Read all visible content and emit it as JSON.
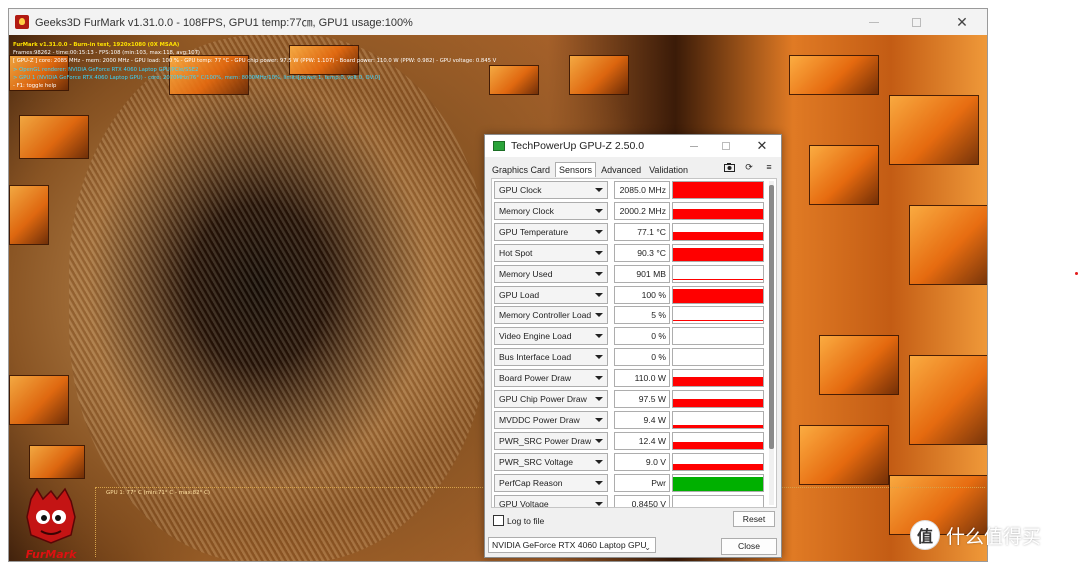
{
  "furmark": {
    "title": "Geeks3D FurMark v1.31.0.0 - 108FPS, GPU1 temp:77㎝, GPU1 usage:100%",
    "overlay": [
      "FurMark v1.31.0.0 - Burn-in test, 1920x1080 (0X MSAA)",
      "Frames:98262 - time:00:15:13 - FPS:108 (min:103, max:118, avg:107)",
      "[ GPU-Z ] core: 2085 MHz - mem: 2000 MHz - GPU load: 100 % - GPU temp: 77 °C - GPU chip power: 97.5 W (PPW: 1.107) - Board power: 110.0 W (PPW: 0.982) - GPU voltage: 0.845 V",
      "> OpenGL renderer: NVIDIA GeForce RTX 4060 Laptop GPU/PCIe/SSE2",
      "> GPU 1 (NVIDIA GeForce RTX 4060 Laptop GPU) - core: 2070MHz/76° C/100%, mem: 8000MHz/10%, limits[power:1, temp:0, volt:0, OV:0]",
      "- F1: toggle help"
    ],
    "graph_label": "GPU 1: 77° C (min:71° C - max:82° C)",
    "logo_text": "FurMark"
  },
  "gpuz": {
    "title": "TechPowerUp GPU-Z 2.50.0",
    "tabs": [
      "Graphics Card",
      "Sensors",
      "Advanced",
      "Validation"
    ],
    "active_tab": "Sensors",
    "sensors": [
      {
        "label": "GPU Clock",
        "value": "2085.0 MHz",
        "level": 1.0,
        "type": "full"
      },
      {
        "label": "Memory Clock",
        "value": "2000.2 MHz",
        "level": 0.6,
        "type": "full"
      },
      {
        "label": "GPU Temperature",
        "value": "77.1 °C",
        "level": 0.5,
        "type": "full"
      },
      {
        "label": "Hot Spot",
        "value": "90.3 °C",
        "level": 0.8,
        "type": "full"
      },
      {
        "label": "Memory Used",
        "value": "901 MB",
        "level": 0.1,
        "type": "line"
      },
      {
        "label": "GPU Load",
        "value": "100 %",
        "level": 0.85,
        "type": "full"
      },
      {
        "label": "Memory Controller Load",
        "value": "5 %",
        "level": 0.05,
        "type": "line"
      },
      {
        "label": "Video Engine Load",
        "value": "0 %",
        "level": 0.0,
        "type": "empty"
      },
      {
        "label": "Bus Interface Load",
        "value": "0 %",
        "level": 0.0,
        "type": "empty"
      },
      {
        "label": "Board Power Draw",
        "value": "110.0 W",
        "level": 0.55,
        "type": "full"
      },
      {
        "label": "GPU Chip Power Draw",
        "value": "97.5 W",
        "level": 0.5,
        "type": "full"
      },
      {
        "label": "MVDDC Power Draw",
        "value": "9.4 W",
        "level": 0.2,
        "type": "full"
      },
      {
        "label": "PWR_SRC Power Draw",
        "value": "12.4 W",
        "level": 0.45,
        "type": "full"
      },
      {
        "label": "PWR_SRC Voltage",
        "value": "9.0 V",
        "level": 0.35,
        "type": "full"
      },
      {
        "label": "PerfCap Reason",
        "value": "Pwr",
        "level": 0.85,
        "type": "green"
      },
      {
        "label": "GPU Voltage",
        "value": "0.8450 V",
        "level": 0.25,
        "type": "full"
      }
    ],
    "log_to_file": "Log to file",
    "reset": "Reset",
    "gpu_select": "NVIDIA GeForce RTX 4060 Laptop GPU",
    "close": "Close"
  },
  "watermark": {
    "logo": "值",
    "text": "什么值得买"
  },
  "colors": {
    "sensor_bar": "#ff0000",
    "perfcap_bar": "#00b000",
    "overlay_yellow": "#ffe200",
    "overlay_cyan": "#37d6ff"
  }
}
